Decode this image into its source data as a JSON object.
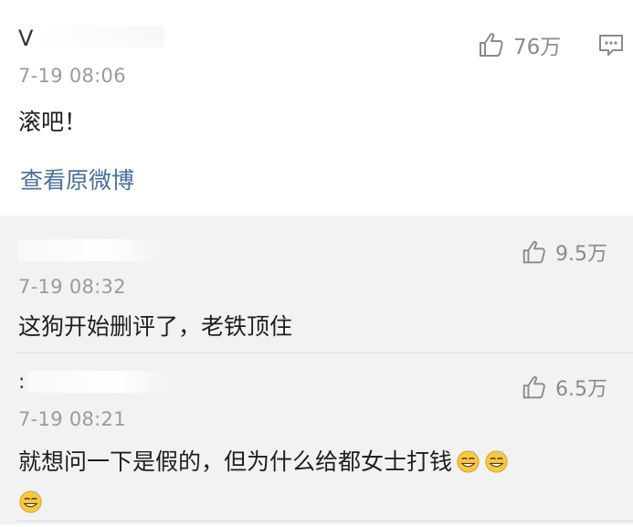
{
  "main": {
    "time": "7-19 08:06",
    "text": "滚吧！",
    "likes": "76万",
    "view_original": "查看原微博",
    "icons": {
      "like": "thumbs-up-icon",
      "comment": "comment-icon"
    }
  },
  "replies": [
    {
      "time": "7-19 08:32",
      "text": "这狗开始删评了，老铁顶住",
      "likes": "9.5万"
    },
    {
      "time": "7-19 08:21",
      "text": "就想问一下是假的，但为什么给都女士打钱",
      "likes": "6.5万",
      "emoji": "grinning-sweat-emoji"
    }
  ],
  "colors": {
    "link": "#4a6f9c",
    "meta": "#9b9b9b",
    "reply_bg": "#f2f2f2"
  }
}
